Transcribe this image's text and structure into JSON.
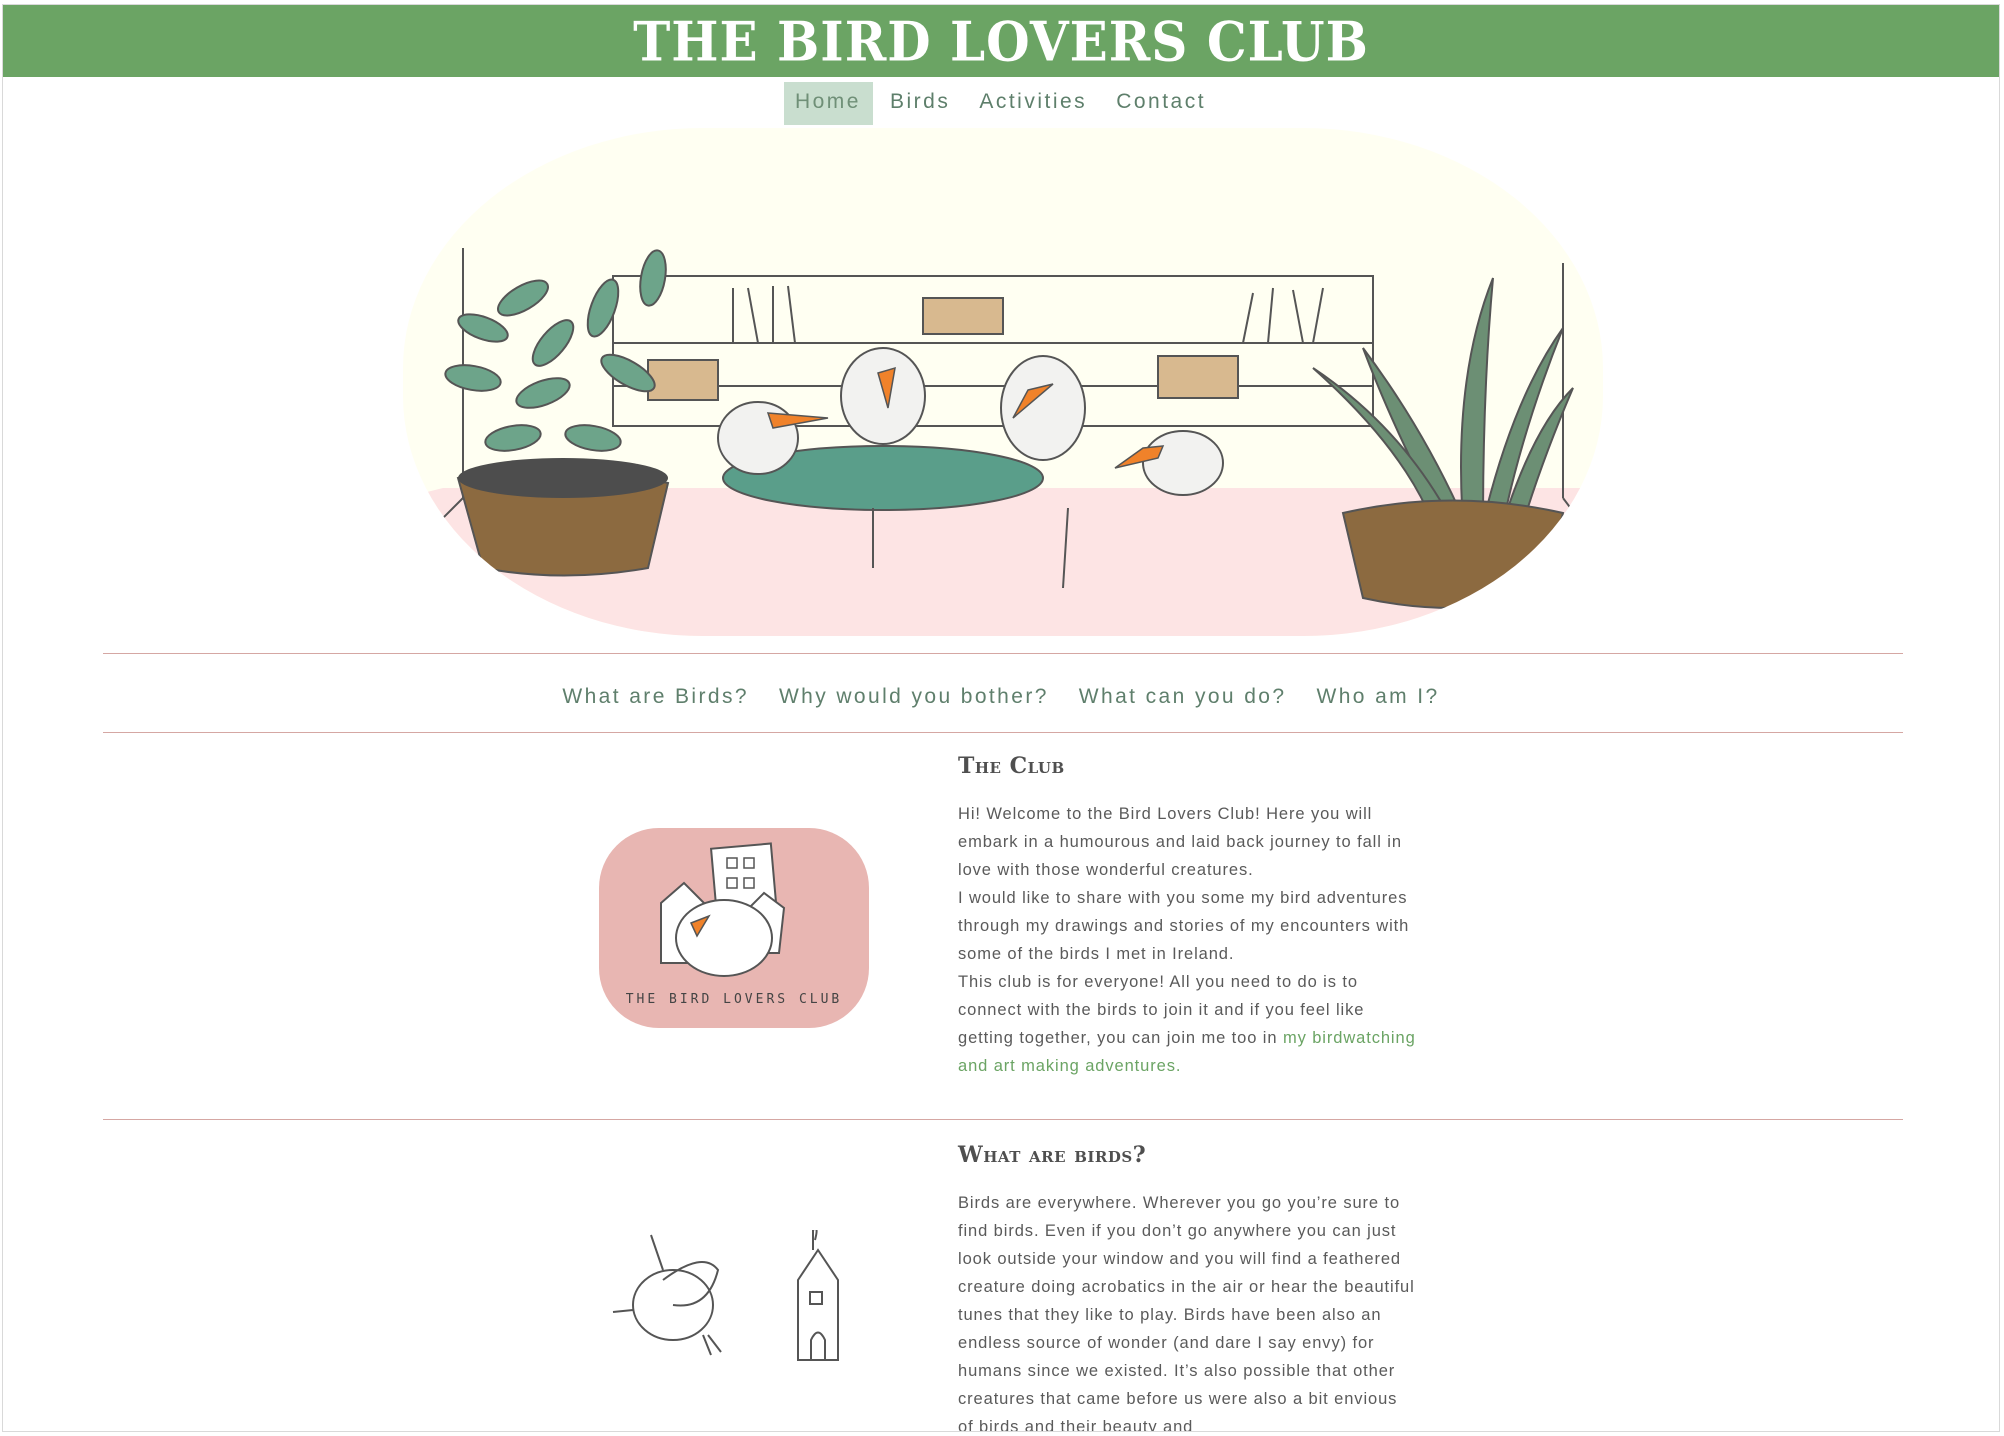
{
  "site": {
    "title": "THE BIRD LOVERS CLUB"
  },
  "nav": {
    "items": [
      {
        "label": "Home",
        "active": true
      },
      {
        "label": "Birds",
        "active": false
      },
      {
        "label": "Activities",
        "active": false
      },
      {
        "label": "Contact",
        "active": false
      }
    ]
  },
  "sub_nav": {
    "items": [
      "What are Birds?",
      "Why would you bother?",
      "What can you do?",
      "Who am I?"
    ]
  },
  "club": {
    "title": "The Club",
    "p1": "Hi! Welcome to the Bird Lovers Club! Here you will embark in a humourous and laid back journey to fall in love with those wonderful creatures.",
    "p2": "I would like to share with you some my bird adventures through my drawings and stories of my encounters with some of the birds I met in Ireland.",
    "p3_pre": "This club is for everyone! All you need to do is to connect with the birds to join it and if you feel like getting together, you can join me too in ",
    "p3_link": "my birdwatching and art making adventures.",
    "badge_text": "THE BIRD LOVERS CLUB"
  },
  "birds": {
    "title": "What are birds?",
    "p1": "Birds are everywhere. Wherever you go you’re sure to find birds. Even if you don’t go anywhere you can just look outside your window and you will find a feathered creature doing acrobatics in the air or hear the beautiful tunes that they like to play. Birds have been also an endless source of wonder (and dare I say envy) for humans since we existed. It’s also possible that other creatures that came before us were also a bit envious of birds and their beauty and"
  },
  "colors": {
    "brand_green": "#6ba464",
    "nav_active_bg": "#c9decf",
    "divider": "#d5a7a3",
    "badge_pink": "#e8b6b2"
  }
}
